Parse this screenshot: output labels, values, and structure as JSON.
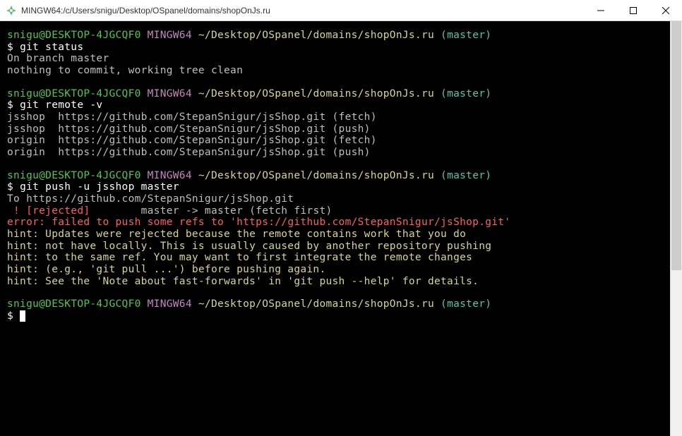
{
  "window": {
    "title": "MINGW64:/c/Users/snigu/Desktop/OSpanel/domains/shopOnJs.ru"
  },
  "prompt": {
    "user": "snigu@DESKTOP-4JGCQF0",
    "env": "MINGW64",
    "path": "~/Desktop/OSpanel/domains/shopOnJs.ru",
    "branch": "(master)",
    "dollar": "$"
  },
  "blocks": {
    "b1": {
      "cmd": "git status",
      "out1": "On branch master",
      "out2": "nothing to commit, working tree clean"
    },
    "b2": {
      "cmd": "git remote -v",
      "out1": "jsshop  https://github.com/StepanSnigur/jsShop.git (fetch)",
      "out2": "jsshop  https://github.com/StepanSnigur/jsShop.git (push)",
      "out3": "origin  https://github.com/StepanSnigur/jsShop.git (fetch)",
      "out4": "origin  https://github.com/StepanSnigur/jsShop.git (push)"
    },
    "b3": {
      "cmd": "git push -u jsshop master",
      "out1": "To https://github.com/StepanSnigur/jsShop.git",
      "rejected_bang": " ! [rejected]       ",
      "rejected_rest": " master -> master (fetch first)",
      "err_pre": "error: failed to push some refs to '",
      "err_url": "https://github.com/StepanSnigur/jsShop.git",
      "err_post": "'",
      "h1": "hint: Updates were rejected because the remote contains work that you do",
      "h2": "hint: not have locally. This is usually caused by another repository pushing",
      "h3": "hint: to the same ref. You may want to first integrate the remote changes",
      "h4": "hint: (e.g., 'git pull ...') before pushing again.",
      "h5": "hint: See the 'Note about fast-forwards' in 'git push --help' for details."
    }
  }
}
